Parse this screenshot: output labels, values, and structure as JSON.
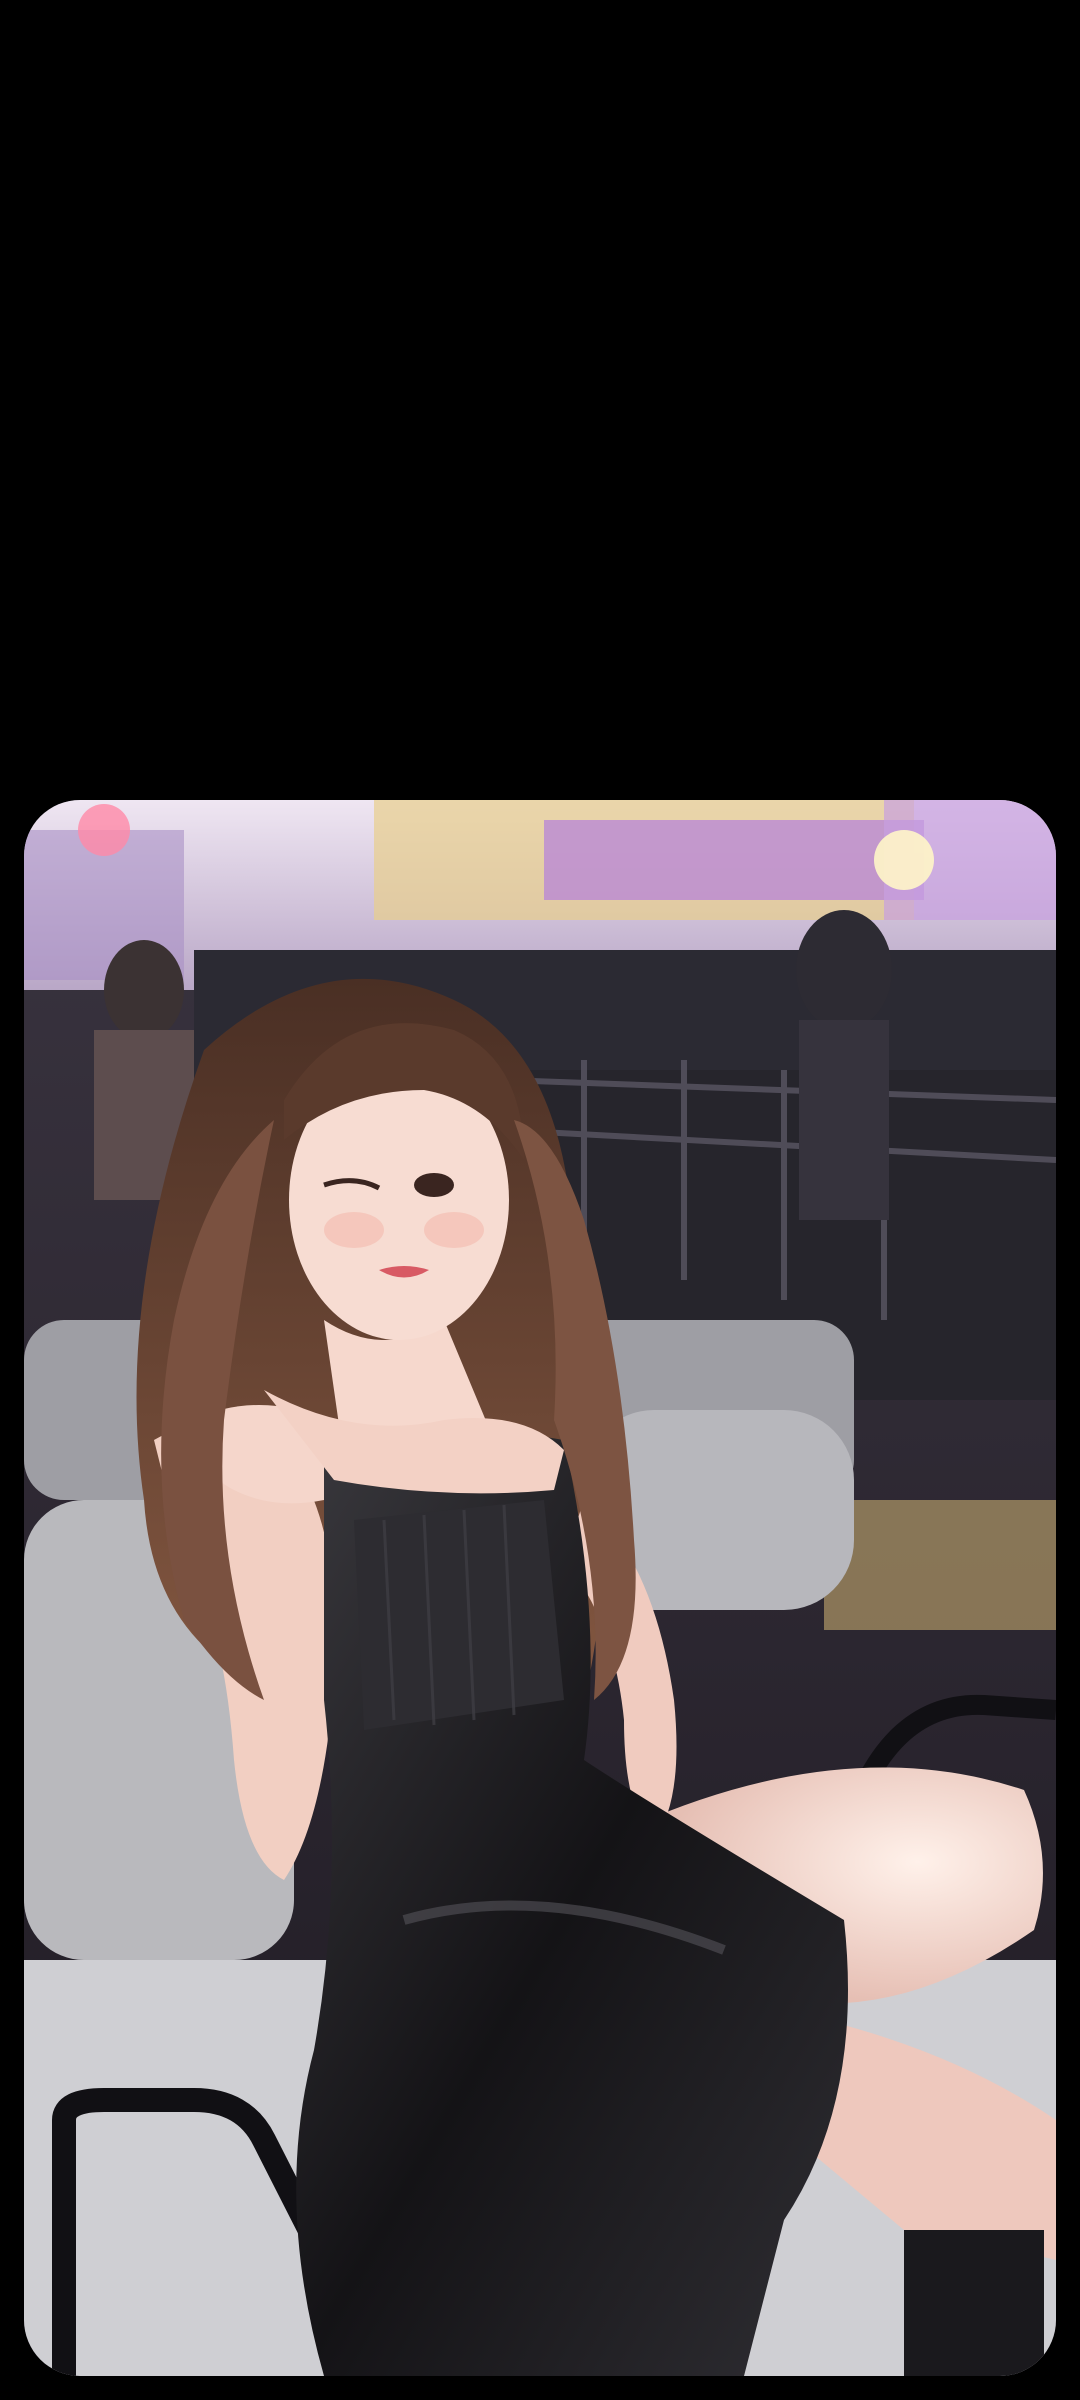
{
  "screen": {
    "background_color": "#000000"
  },
  "photo": {
    "subject": "photo",
    "palette": {
      "sky": "#e9dff0",
      "stage_lights": "#c9a6e6",
      "stage_glow": "#f3e3a0",
      "barrier": "#2b2a33",
      "sofa": "#b9b9bd",
      "dress": "#1c1b1f",
      "hair": "#6b4636",
      "skin": "#f4d3c6"
    }
  }
}
